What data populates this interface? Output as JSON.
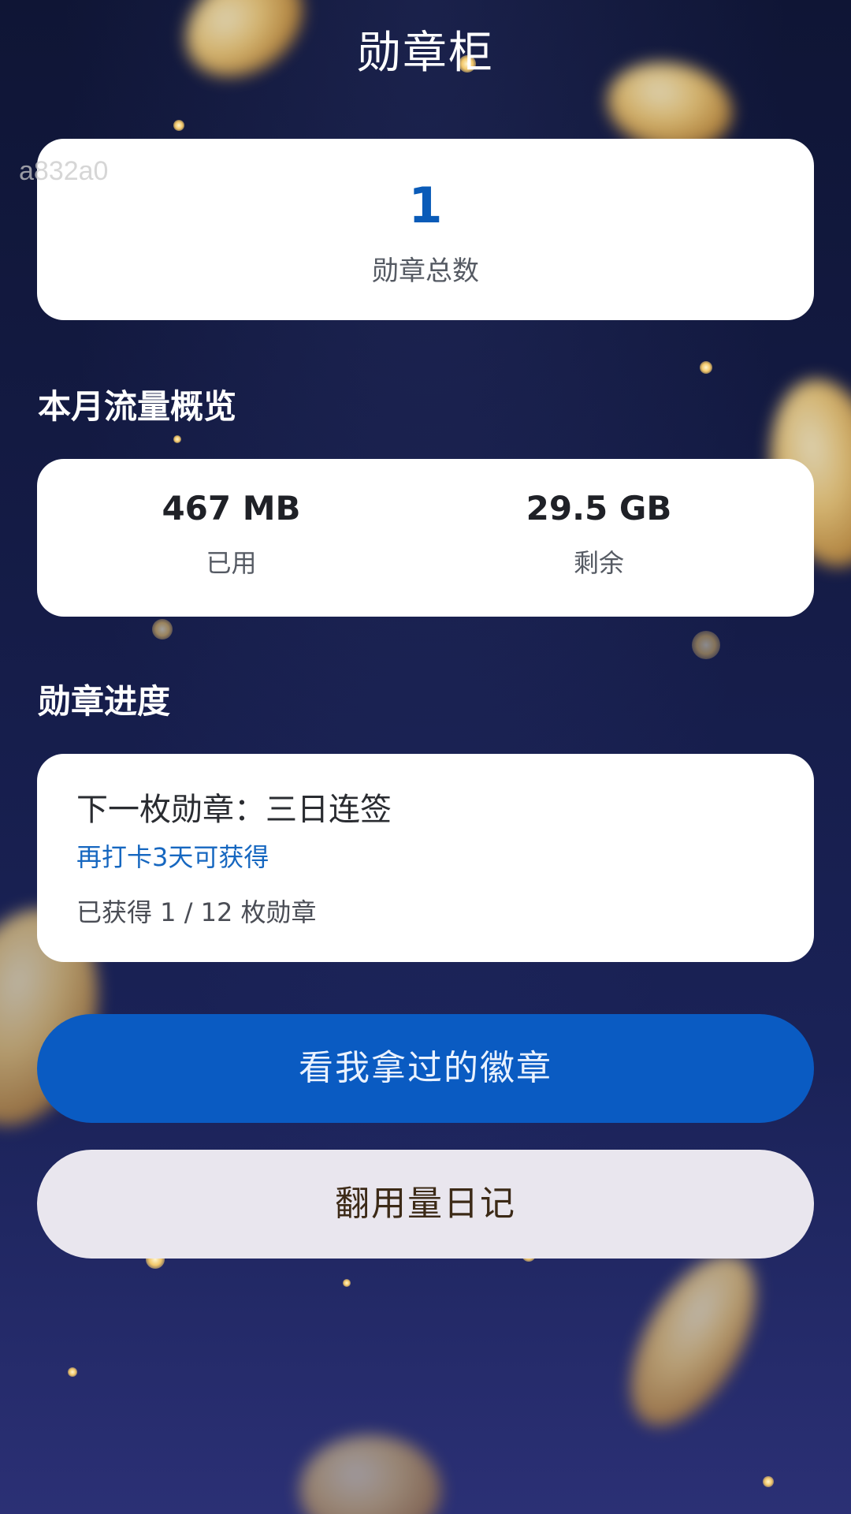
{
  "header": {
    "title": "勋章柜"
  },
  "watermark": "a832a0",
  "badge_summary": {
    "total": "1",
    "total_label": "勋章总数"
  },
  "traffic": {
    "section_title": "本月流量概览",
    "used_value": "467 MB",
    "used_label": "已用",
    "remaining_value": "29.5 GB",
    "remaining_label": "剩余"
  },
  "progress": {
    "section_title": "勋章进度",
    "next_badge": "下一枚勋章：三日连签",
    "hint": "再打卡3天可获得",
    "earned": "已获得 1 / 12 枚勋章"
  },
  "actions": {
    "view_badges": "看我拿过的徽章",
    "usage_diary": "翻用量日记"
  },
  "colors": {
    "accent": "#0a5bc2",
    "number": "#0a5bb8",
    "hint": "#1667c0",
    "background": "#141b45"
  }
}
